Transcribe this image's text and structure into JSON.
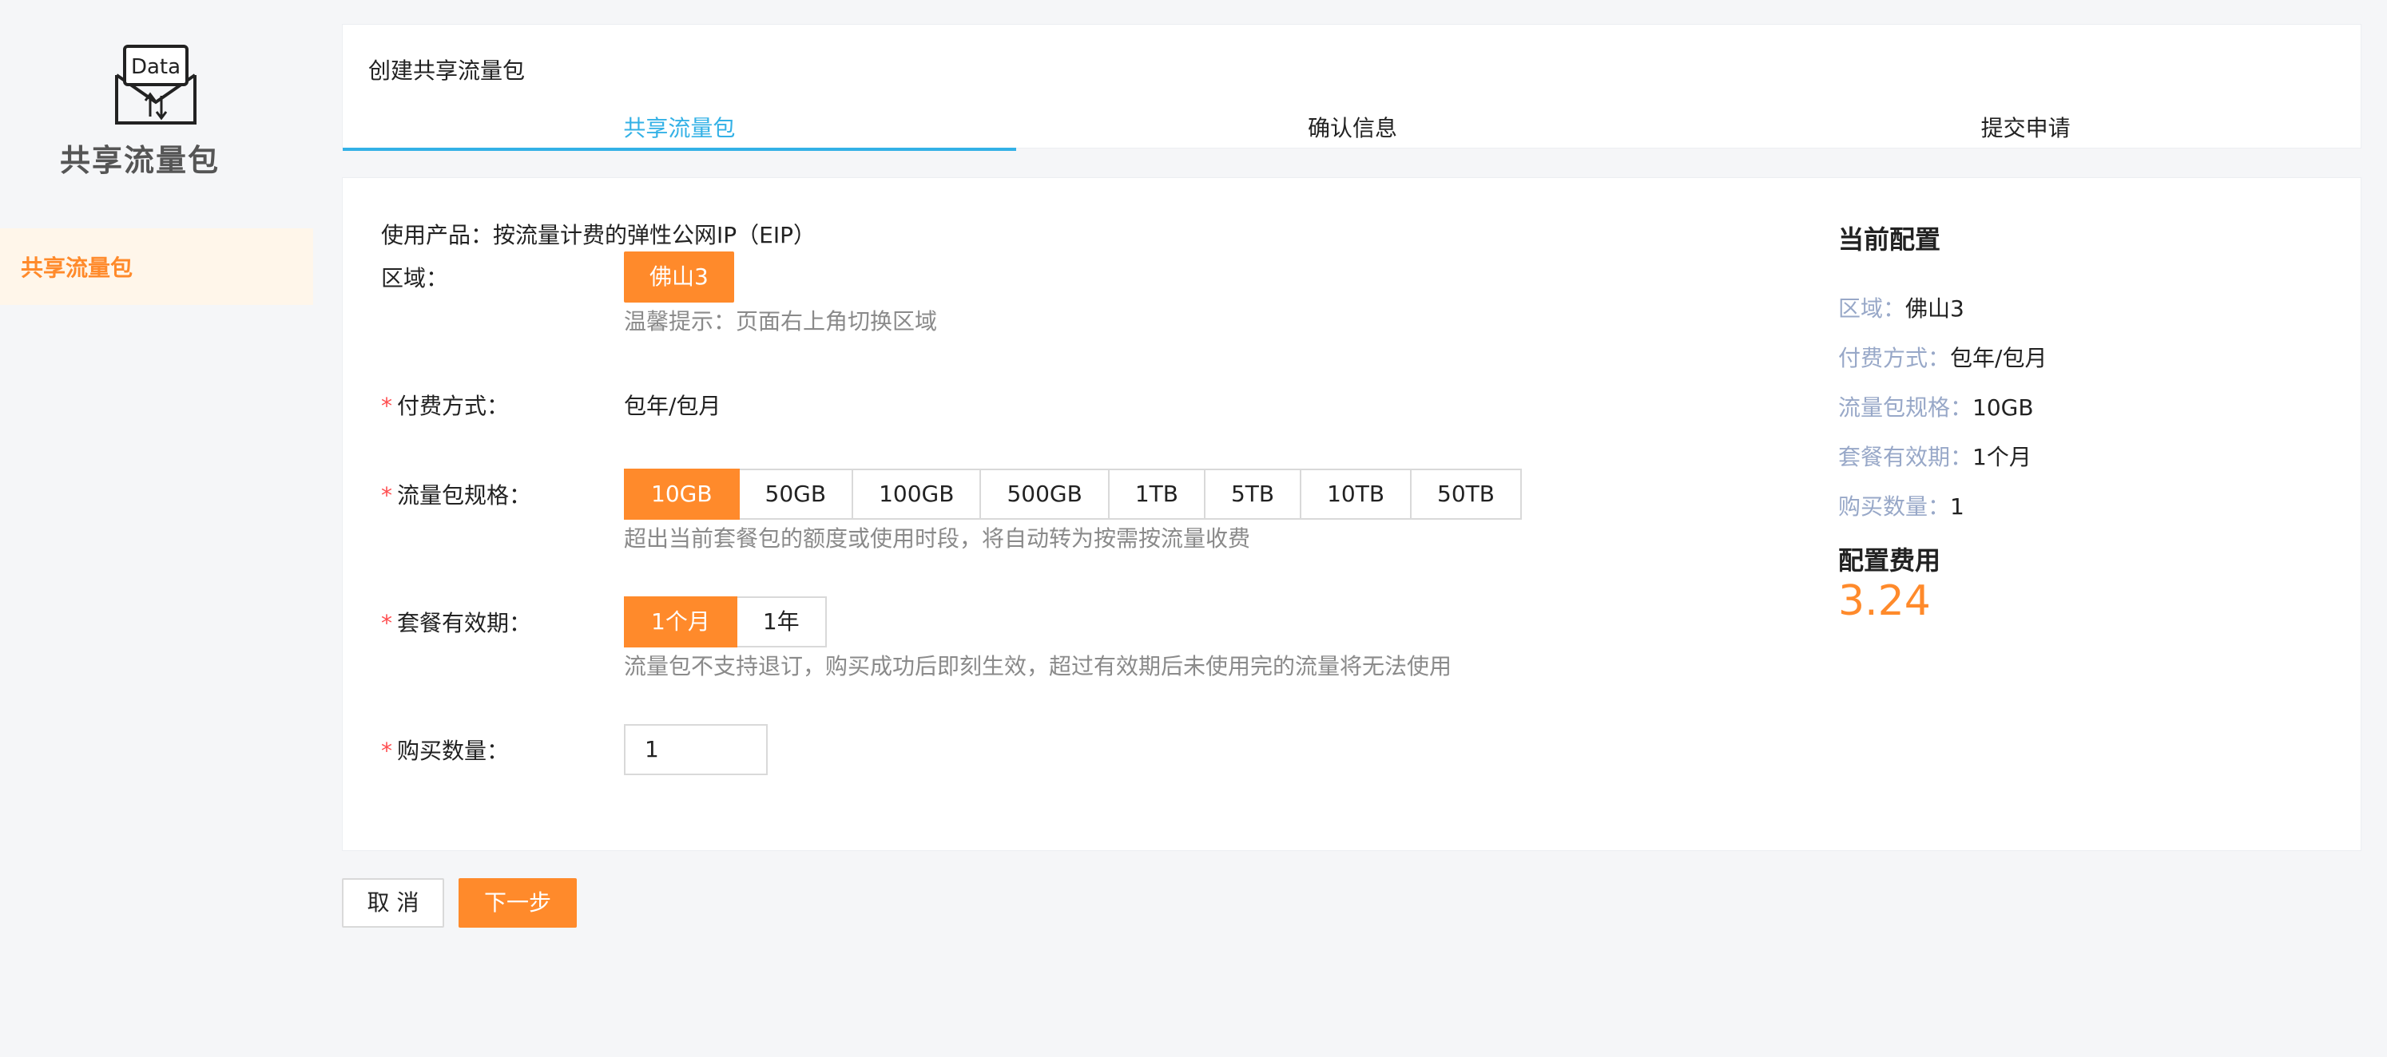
{
  "sidebar": {
    "logo_icon_text": "Data",
    "logo_title": "共享流量包",
    "items": [
      {
        "label": "共享流量包"
      }
    ]
  },
  "header": {
    "title": "创建共享流量包",
    "steps": [
      {
        "label": "共享流量包",
        "active": true
      },
      {
        "label": "确认信息",
        "active": false
      },
      {
        "label": "提交申请",
        "active": false
      }
    ]
  },
  "form": {
    "product": "使用产品：按流量计费的弹性公网IP（EIP）",
    "region": {
      "label": "区域：",
      "value": "佛山3",
      "hint": "温馨提示：页面右上角切换区域"
    },
    "billing": {
      "required_mark": "*",
      "label": "付费方式：",
      "value": "包年/包月"
    },
    "spec": {
      "required_mark": "*",
      "label": "流量包规格：",
      "options": [
        "10GB",
        "50GB",
        "100GB",
        "500GB",
        "1TB",
        "5TB",
        "10TB",
        "50TB"
      ],
      "selected": "10GB",
      "hint": "超出当前套餐包的额度或使用时段，将自动转为按需按流量收费"
    },
    "validity": {
      "required_mark": "*",
      "label": "套餐有效期：",
      "options": [
        "1个月",
        "1年"
      ],
      "selected": "1个月",
      "hint": "流量包不支持退订，购买成功后即刻生效，超过有效期后未使用完的流量将无法使用"
    },
    "quantity": {
      "required_mark": "*",
      "label": "购买数量：",
      "value": "1"
    }
  },
  "summary": {
    "title": "当前配置",
    "rows": [
      {
        "key": "区域：",
        "value": "佛山3"
      },
      {
        "key": "付费方式：",
        "value": "包年/包月"
      },
      {
        "key": "流量包规格：",
        "value": "10GB"
      },
      {
        "key": "套餐有效期：",
        "value": "1个月"
      },
      {
        "key": "购买数量：",
        "value": "1"
      }
    ],
    "cost_label": "配置费用",
    "cost_value": "3.24"
  },
  "footer": {
    "cancel_label": "取 消",
    "next_label": "下一步"
  },
  "colors": {
    "accent": "#ff8a2b",
    "step_active": "#33b1e6",
    "summary_key": "#98a8c8",
    "required": "#ff4d4f"
  }
}
